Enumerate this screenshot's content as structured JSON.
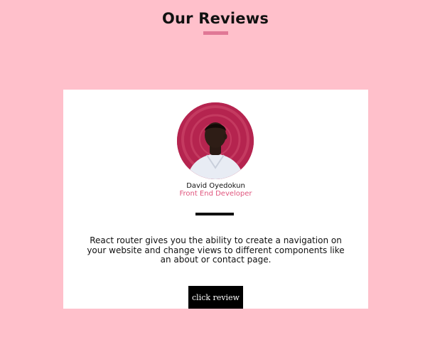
{
  "header": {
    "title": "Our Reviews"
  },
  "review": {
    "name": "David Oyedokun",
    "role": "Front End Developer",
    "text": "React router gives you the ability to create a navigation on your website and change views to different components like an about or contact page.",
    "button_label": "click review"
  },
  "colors": {
    "background": "#ffc0cb",
    "accent": "#e07896",
    "role_text": "#e0557d",
    "avatar_bg": "#b5244f",
    "button_bg": "#000000"
  }
}
